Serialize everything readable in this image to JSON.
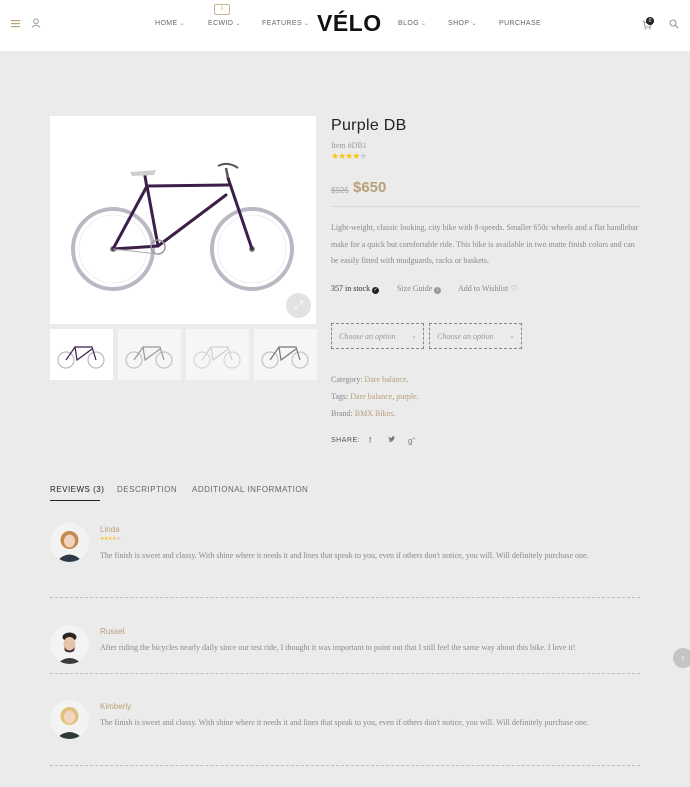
{
  "header": {
    "logo": "VÉLO",
    "nav": [
      {
        "label": "HOME",
        "dropdown": true
      },
      {
        "label": "ECWID",
        "dropdown": true
      },
      {
        "label": "FEATURES",
        "dropdown": true
      },
      {
        "label": "BLOG",
        "dropdown": true
      },
      {
        "label": "SHOP",
        "dropdown": true
      },
      {
        "label": "PURCHASE",
        "dropdown": false
      }
    ],
    "cart_count": "0",
    "icons": [
      "menu-icon",
      "user-icon",
      "cart-icon",
      "search-icon"
    ]
  },
  "product": {
    "title": "Purple DB",
    "item_id": "Item #DB1",
    "rating": 4,
    "rating_max": 5,
    "old_price": "$925",
    "price": "$650",
    "description": "Light-weight, classic looking, city bike with 8-speeds. Smaller 650c wheels and a flat handlebar make for a quick but comfortable ride. This bike is available in two matte finish colors and can be easily fitted with mudguards, racks or baskets.",
    "stock": "357 in stock",
    "size_guide": "Size Guide",
    "wishlist": "Add to Wishlist",
    "option1_placeholder": "Choose an option",
    "option2_placeholder": "Choose an option",
    "category_label": "Category:",
    "category": "Dare balance",
    "tags_label": "Tags:",
    "tag1": "Dare balance",
    "tag2": "purple",
    "brand_label": "Brand:",
    "brand": "BMX Bikes",
    "share_label": "SHARE:",
    "colors": {
      "frame": "#3b1f4a",
      "accent": "#b8a079",
      "star": "#f5c518"
    }
  },
  "tabs": [
    {
      "label": "REVIEWS (3)",
      "active": true
    },
    {
      "label": "DESCRIPTION",
      "active": false
    },
    {
      "label": "ADDITIONAL INFORMATION",
      "active": false
    }
  ],
  "reviews": [
    {
      "name": "Linda",
      "rating": 4,
      "text": "The finish is sweet and classy. With shine where it needs it and lines that speak to you, even if others don't notice, you will. Will definitely purchase one."
    },
    {
      "name": "Russel",
      "text": "After riding the bicycles nearly daily since our test ride, I thought it was important to point out that I still feel the same way about this bike. I love it!"
    },
    {
      "name": "Kimberly",
      "text": "The finish is sweet and classy. With shine where it needs it and lines that speak to you, even if others don't notice, you will. Will definitely purchase one."
    }
  ]
}
